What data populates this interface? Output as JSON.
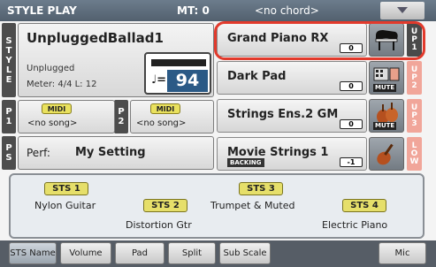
{
  "header": {
    "title": "STYLE PLAY",
    "mt": "MT: 0",
    "chord": "<no chord>"
  },
  "side_labels": {
    "style": [
      "S",
      "T",
      "Y",
      "L",
      "E"
    ],
    "p1": [
      "P",
      "1"
    ],
    "p2": [
      "P",
      "2"
    ],
    "ps": [
      "P",
      "S"
    ]
  },
  "style": {
    "name": "UnpluggedBallad1",
    "category": "Unplugged",
    "meter": "Meter: 4/4  L: 12",
    "tempo_note": "♩=",
    "tempo": "94"
  },
  "players": [
    {
      "badge": "MIDI",
      "song": "<no song>"
    },
    {
      "badge": "MIDI",
      "song": "<no song>"
    }
  ],
  "performance": {
    "label": "Perf:",
    "name": "My Setting"
  },
  "sounds": [
    {
      "name": "Grand Piano RX",
      "octave": "0",
      "part": [
        "U",
        "P",
        "1"
      ],
      "part_color": "#4a4a4a",
      "icon": "grand-piano-icon",
      "muted": false
    },
    {
      "name": "Dark Pad",
      "octave": "0",
      "part": [
        "U",
        "P",
        "2"
      ],
      "part_color": "#f1a69a",
      "icon": "synth-pad-icon",
      "muted": true,
      "mute_label": "MUTE"
    },
    {
      "name": "Strings Ens.2 GM",
      "octave": "0",
      "part": [
        "U",
        "P",
        "3"
      ],
      "part_color": "#f1a69a",
      "icon": "strings-icon",
      "muted": true,
      "mute_label": "MUTE"
    },
    {
      "name": "Movie Strings 1",
      "octave": "-1",
      "part": [
        "L",
        "O",
        "W"
      ],
      "part_color": "#f1a69a",
      "icon": "violin-icon",
      "muted": false,
      "badge": "BACKING"
    }
  ],
  "sts": [
    {
      "button": "STS 1",
      "label": "Nylon Guitar"
    },
    {
      "button": "STS 2",
      "label": "Distortion Gtr"
    },
    {
      "button": "STS 3",
      "label": "Trumpet & Muted"
    },
    {
      "button": "STS 4",
      "label": "Electric Piano"
    }
  ],
  "tabs": [
    "STS Name",
    "Volume",
    "Pad",
    "Split",
    "Sub Scale",
    "Mic"
  ],
  "colors": {
    "accent_ring": "#e23a2c",
    "tempo_bg": "#2b5a86",
    "sts_yellow": "#e6df6a"
  }
}
